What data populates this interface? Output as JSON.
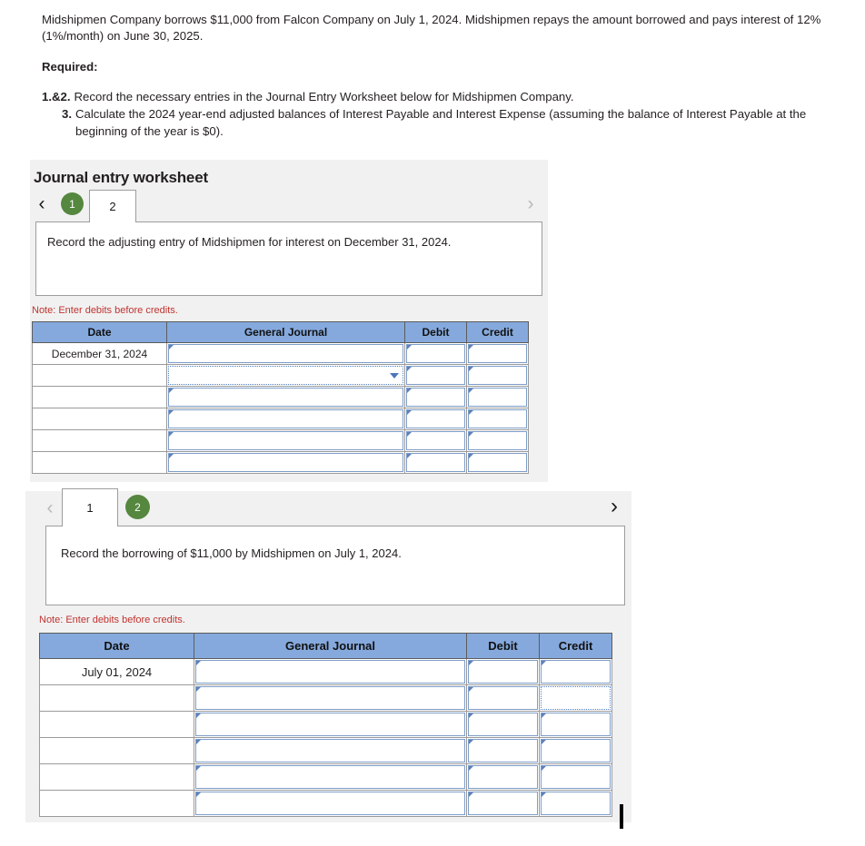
{
  "problem": {
    "statement": "Midshipmen Company borrows $11,000 from Falcon Company on July 1, 2024. Midshipmen repays the amount borrowed and pays interest of 12% (1%/month) on June 30, 2025.",
    "required_label": "Required:",
    "requirements": [
      {
        "num": "1.&2.",
        "text": "Record the necessary entries in the Journal Entry Worksheet below for Midshipmen Company."
      },
      {
        "num": "3.",
        "text": "Calculate the 2024 year-end adjusted balances of Interest Payable and Interest Expense (assuming the balance of Interest Payable at the beginning of the year is $0)."
      }
    ]
  },
  "worksheet_title": "Journal entry worksheet",
  "note": "Note: Enter debits before credits.",
  "columns": [
    "Date",
    "General Journal",
    "Debit",
    "Credit"
  ],
  "nav": {
    "prev_icon": "chevron-left-icon",
    "next_icon": "chevron-right-icon",
    "prev_glyph": "‹",
    "next_glyph": "›"
  },
  "panel_1": {
    "tabs": [
      {
        "label": "1",
        "state": "completed"
      },
      {
        "label": "2",
        "state": "active"
      }
    ],
    "prev_enabled": true,
    "next_enabled": false,
    "prompt": "Record the adjusting entry of Midshipmen for interest on December 31, 2024.",
    "rows": [
      {
        "date": "December 31, 2024",
        "journal": "",
        "debit": "",
        "credit": "",
        "selected": "none",
        "dropdown": false
      },
      {
        "date": "",
        "journal": "",
        "debit": "",
        "credit": "",
        "selected": "journal",
        "dropdown": true
      },
      {
        "date": "",
        "journal": "",
        "debit": "",
        "credit": "",
        "selected": "none",
        "dropdown": false
      },
      {
        "date": "",
        "journal": "",
        "debit": "",
        "credit": "",
        "selected": "none",
        "dropdown": false
      },
      {
        "date": "",
        "journal": "",
        "debit": "",
        "credit": "",
        "selected": "none",
        "dropdown": false
      },
      {
        "date": "",
        "journal": "",
        "debit": "",
        "credit": "",
        "selected": "none",
        "dropdown": false
      }
    ]
  },
  "panel_2": {
    "tabs": [
      {
        "label": "1",
        "state": "active"
      },
      {
        "label": "2",
        "state": "completed"
      }
    ],
    "prev_enabled": false,
    "next_enabled": true,
    "prompt": "Record the borrowing of $11,000 by Midshipmen on July 1, 2024.",
    "rows": [
      {
        "date": "July 01, 2024",
        "journal": "",
        "debit": "",
        "credit": "",
        "selected": "none",
        "dropdown": false
      },
      {
        "date": "",
        "journal": "",
        "debit": "",
        "credit": "",
        "selected": "credit",
        "dropdown": false
      },
      {
        "date": "",
        "journal": "",
        "debit": "",
        "credit": "",
        "selected": "none",
        "dropdown": false
      },
      {
        "date": "",
        "journal": "",
        "debit": "",
        "credit": "",
        "selected": "none",
        "dropdown": false
      },
      {
        "date": "",
        "journal": "",
        "debit": "",
        "credit": "",
        "selected": "none",
        "dropdown": false
      },
      {
        "date": "",
        "journal": "",
        "debit": "",
        "credit": "",
        "selected": "none",
        "dropdown": false
      }
    ]
  },
  "colors": {
    "header_blue": "#85a9dd",
    "badge_green": "#55873f",
    "note_red": "#c0332f",
    "panel_gray": "#f1f1f1",
    "input_border_blue": "#7d9dc9"
  }
}
